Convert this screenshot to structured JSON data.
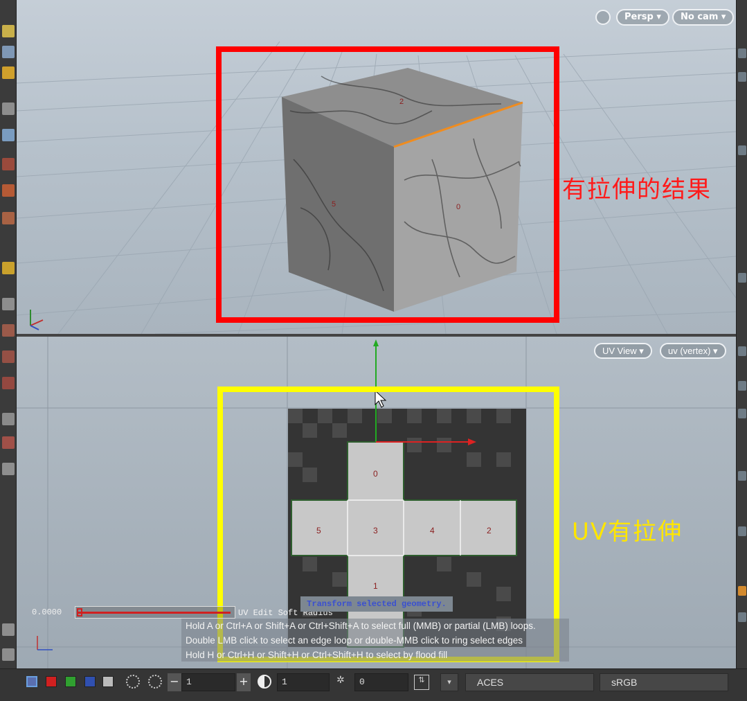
{
  "viewport3d": {
    "persp_label": "Persp ▾",
    "cam_label": "No cam ▾",
    "face_labels": {
      "top": "2",
      "left": "5",
      "right": "0"
    }
  },
  "viewport_uv": {
    "view_label": "UV View ▾",
    "attr_label": "uv (vertex) ▾",
    "face_labels": [
      "0",
      "5",
      "3",
      "4",
      "2",
      "1"
    ]
  },
  "annotations": {
    "stretched_result": "有拉伸的结果",
    "uv_stretched": "UV有拉伸"
  },
  "soft_radius": {
    "value": "0.0000",
    "label": "UV Edit Soft Radius"
  },
  "tooltip": {
    "title": "Transform selected geometry."
  },
  "hints": [
    "Hold A or Ctrl+A or Shift+A or Ctrl+Shift+A to select full (MMB) or partial (LMB) loops.",
    "Double LMB click to select an edge loop or double-MMB click to ring select edges",
    "Hold H or Ctrl+H or Shift+H or Ctrl+Shift+H to select by flood fill"
  ],
  "bottom_bar": {
    "field_1": "1",
    "field_2": "1",
    "field_3": "0",
    "color_space": "ACES",
    "display": "sRGB"
  },
  "colors": {
    "red_frame": "#ff0000",
    "yellow_frame": "#ffff00",
    "edge_highlight": "#f08c1e"
  }
}
